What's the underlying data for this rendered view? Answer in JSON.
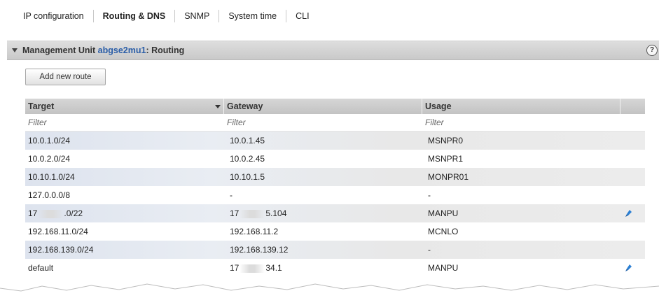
{
  "tabs": [
    {
      "label": "IP configuration",
      "active": false
    },
    {
      "label": "Routing & DNS",
      "active": true
    },
    {
      "label": "SNMP",
      "active": false
    },
    {
      "label": "System time",
      "active": false
    },
    {
      "label": "CLI",
      "active": false
    }
  ],
  "panel": {
    "prefix": "Management Unit",
    "unit_name": "abgse2mu1",
    "suffix": ": Routing",
    "help_glyph": "?"
  },
  "toolbar": {
    "add_route_label": "Add new route"
  },
  "table": {
    "columns": [
      "Target",
      "Gateway",
      "Usage"
    ],
    "filter_placeholder": "Filter",
    "rows": [
      {
        "target": "10.0.1.0/24",
        "gateway": "10.0.1.45",
        "usage": "MSNPR0",
        "editable": false
      },
      {
        "target": "10.0.2.0/24",
        "gateway": "10.0.2.45",
        "usage": "MSNPR1",
        "editable": false
      },
      {
        "target": "10.10.1.0/24",
        "gateway": "10.10.1.5",
        "usage": "MONPR01",
        "editable": false
      },
      {
        "target": "127.0.0.0/8",
        "gateway": "-",
        "usage": "-",
        "editable": false
      },
      {
        "target_a": "17",
        "target_b": ".0/22",
        "gateway_a": "17",
        "gateway_b": "5.104",
        "usage": "MANPU",
        "editable": true
      },
      {
        "target": "192.168.11.0/24",
        "gateway": "192.168.11.2",
        "usage": "MCNLO",
        "editable": false
      },
      {
        "target": "192.168.139.0/24",
        "gateway": "192.168.139.12",
        "usage": "-",
        "editable": false
      },
      {
        "target": "default",
        "gateway_a": "17",
        "gateway_b": "34.1",
        "usage": "MANPU",
        "editable": true
      }
    ]
  },
  "colors": {
    "link": "#2b5ea8",
    "edit_icon": "#2a7fd4",
    "header_bg": "#c9c9c9",
    "row_highlight": "#dde3ee"
  },
  "icons": [
    "collapse-icon",
    "help-icon",
    "sort-desc-icon",
    "edit-icon"
  ]
}
